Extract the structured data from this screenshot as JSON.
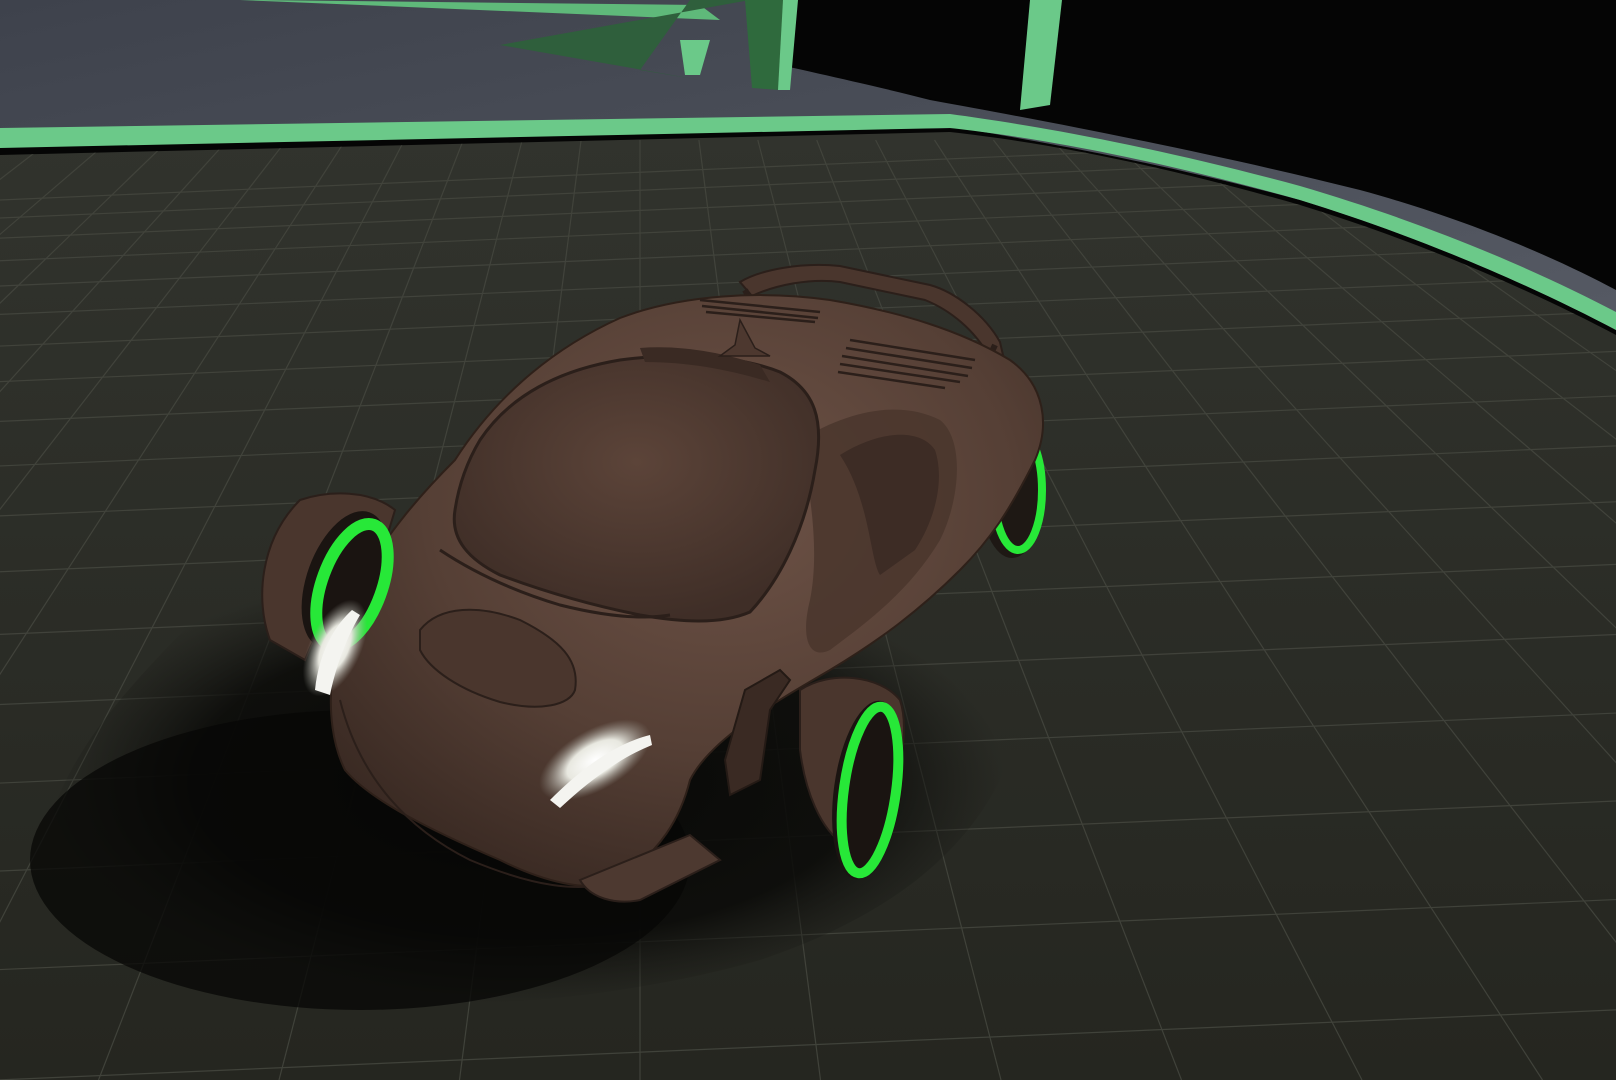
{
  "scene": {
    "description_text": "",
    "colors": {
      "floor": "#2a2b25",
      "floor_far": "#30322d",
      "grid_line": "#4a4c45",
      "track_surface": "#4a4d57",
      "neon_green": "#6bc989",
      "neon_rim": "#27e838",
      "sky": "#050505",
      "wall_grid": "#2c2c2c",
      "car_body": "#5a4339",
      "car_body_light": "#6e5347",
      "car_body_dark": "#3a2a23",
      "headlight": "#f4f4f0",
      "shadow": "#0d0d0b"
    },
    "objects": {
      "car": "futuristic-sports-car",
      "wheels": [
        "front-left-wheel",
        "front-right-wheel",
        "rear-left-wheel",
        "rear-right-wheel"
      ],
      "track": "curved-race-track",
      "floor": "grid-floor",
      "ramp": "green-ramp"
    }
  }
}
